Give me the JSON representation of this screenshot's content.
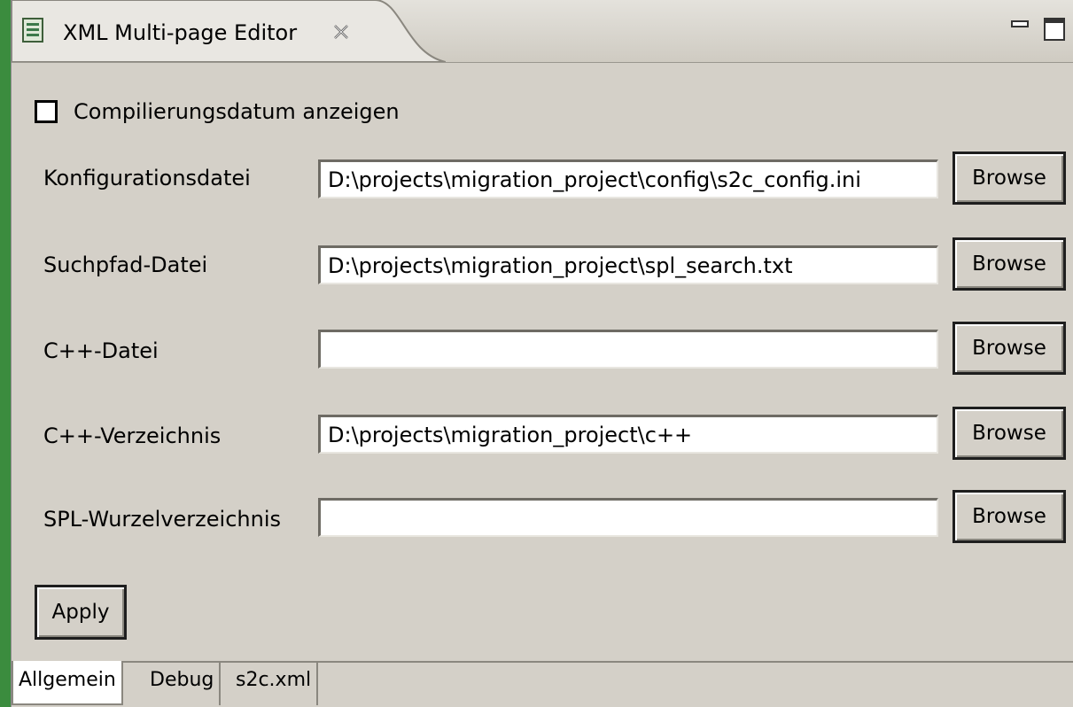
{
  "editor": {
    "tab_title": "XML Multi-page Editor",
    "tab_icon": "xml-file-icon",
    "close_icon": "close-icon",
    "minimize_icon": "minimize-icon",
    "maximize_icon": "maximize-icon"
  },
  "form": {
    "checkbox": {
      "label": "Compilierungsdatum anzeigen",
      "checked": false
    },
    "fields": [
      {
        "label": "Konfigurationsdatei",
        "value": "D:\\projects\\migration_project\\config\\s2c_config.ini",
        "button": "Browse"
      },
      {
        "label": "Suchpfad-Datei",
        "value": "D:\\projects\\migration_project\\spl_search.txt",
        "button": "Browse"
      },
      {
        "label": "C++-Datei",
        "value": "",
        "button": "Browse"
      },
      {
        "label": "C++-Verzeichnis",
        "value": "D:\\projects\\migration_project\\c++",
        "button": "Browse"
      },
      {
        "label": "SPL-Wurzelverzeichnis",
        "value": "",
        "button": "Browse"
      }
    ],
    "apply_label": "Apply"
  },
  "page_tabs": [
    {
      "label": "Allgemein",
      "active": true
    },
    {
      "label": "Debug",
      "active": false
    },
    {
      "label": "s2c.xml",
      "active": false
    }
  ],
  "colors": {
    "background": "#3b8c3e",
    "panel": "#d4d0c8"
  }
}
